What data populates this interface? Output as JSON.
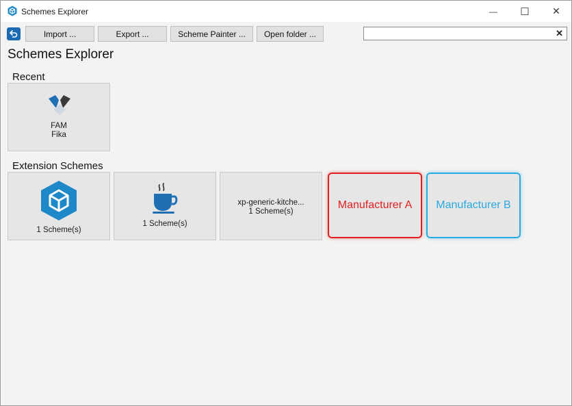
{
  "window": {
    "title": "Schemes Explorer",
    "controls": {
      "minimize": "—",
      "maximize": "☐",
      "close": "✕"
    }
  },
  "toolbar": {
    "import_label": "Import ...",
    "export_label": "Export ...",
    "scheme_painter_label": "Scheme Painter ...",
    "open_folder_label": "Open folder ...",
    "search_value": "",
    "search_clear": "✕"
  },
  "page": {
    "title": "Schemes Explorer"
  },
  "recent": {
    "label": "Recent",
    "items": [
      {
        "line1": "FAM",
        "line2": "Fika",
        "icon": "fam-logo-icon"
      }
    ]
  },
  "extensions": {
    "label": "Extension Schemes",
    "items": [
      {
        "line1": "1 Scheme(s)",
        "icon": "hexagon-cube-icon"
      },
      {
        "line1": "1 Scheme(s)",
        "icon": "coffee-cup-icon"
      },
      {
        "line1": "xp-generic-kitche...",
        "line2": "1 Scheme(s)"
      },
      {
        "line1": "Manufacturer A",
        "color": "#e02020"
      },
      {
        "line1": "Manufacturer B",
        "color": "#29a9e0"
      }
    ]
  },
  "colors": {
    "accent": "#1c6ab2",
    "manufacturer_a": "#e02020",
    "manufacturer_b": "#29a9e0"
  }
}
